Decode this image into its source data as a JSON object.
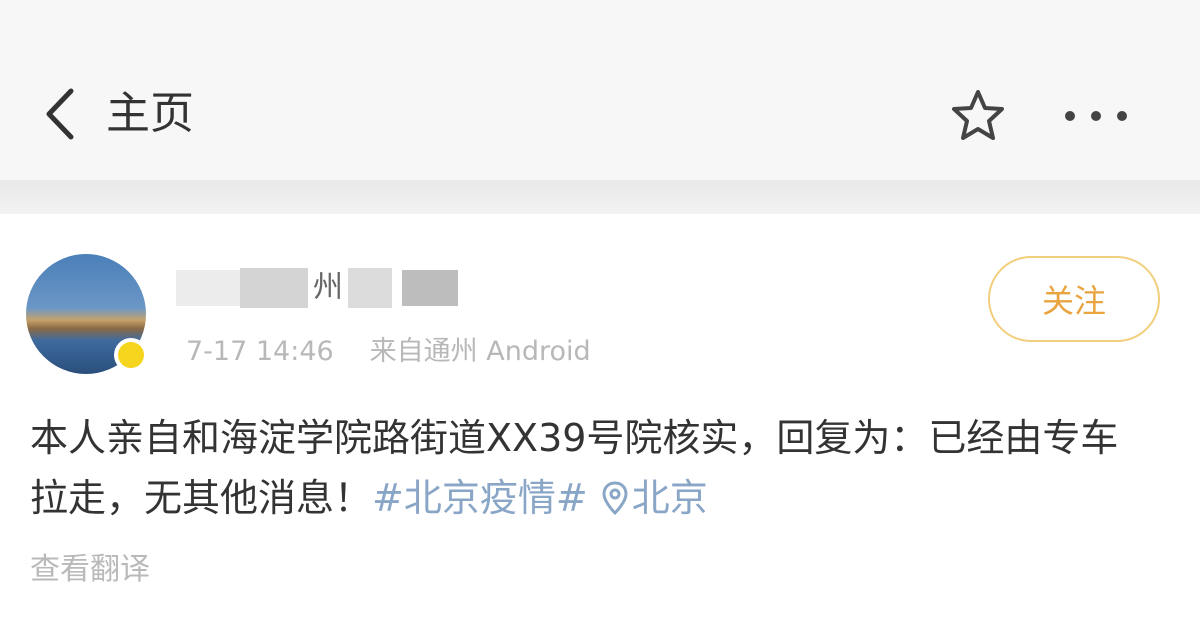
{
  "header": {
    "back_icon": "chevron-left-icon",
    "title": "主页",
    "favorite_icon": "star-icon",
    "more_icon": "more-horizontal-icon"
  },
  "post": {
    "username": "州",
    "meta": {
      "time": "7-17 14:46",
      "source": "来自通州 Android"
    },
    "follow_label": "关注",
    "text": "本人亲自和海淀学院路街道XX39号院核实，回复为：已经由专车拉走，无其他消息！",
    "hashtag": "#北京疫情#",
    "location_icon": "location-pin-icon",
    "location": "北京",
    "translate_label": "查看翻译"
  },
  "colors": {
    "header_bg": "#f7f7f7",
    "link": "#8aa6c7",
    "follow": "#e9a43f",
    "badge": "#f5d51e"
  }
}
